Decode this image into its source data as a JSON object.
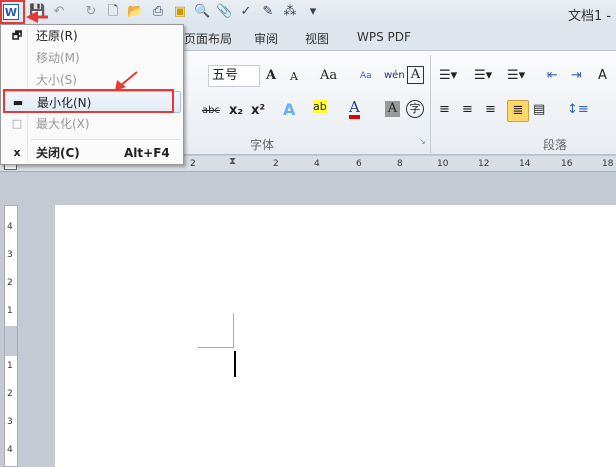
{
  "window": {
    "title": "文档1 -"
  },
  "quick_access": {
    "app_icon": "W",
    "icons": [
      "save-icon",
      "undo-icon",
      "redo-icon",
      "new-icon",
      "open-icon",
      "print-icon",
      "folder-icon",
      "print-preview-icon",
      "attach-icon",
      "spellcheck-icon",
      "edit-icon",
      "structure-icon",
      "customize-icon"
    ]
  },
  "tabs": [
    "页面布局",
    "审阅",
    "视图",
    "WPS PDF"
  ],
  "ribbon": {
    "font_size": "五号",
    "font_group_label": "字体",
    "paragraph_group_label": "段落",
    "buttons": {
      "grow": "A",
      "shrink": "A",
      "change_case": "Aa",
      "strike": "abc",
      "sub": "x₂",
      "sup": "x²",
      "text_effect": "A",
      "highlight": "ab",
      "font_color": "A",
      "char_shade": "A",
      "enclose": "字",
      "pinyin": "wén",
      "char_border": "A"
    }
  },
  "ruler": {
    "h_ticks": [
      "2",
      "2",
      "4",
      "6",
      "8",
      "10",
      "12",
      "14",
      "16",
      "18"
    ],
    "v_ticks": [
      "4",
      "3",
      "2",
      "1",
      "1",
      "2",
      "3",
      "4"
    ]
  },
  "system_menu": {
    "items": [
      {
        "icon": "restore-icon",
        "glyph": "🗗",
        "label": "还原(R)",
        "enabled": true
      },
      {
        "icon": "move-icon",
        "glyph": "",
        "label": "移动(M)",
        "enabled": false
      },
      {
        "icon": "size-icon",
        "glyph": "",
        "label": "大小(S)",
        "enabled": false
      },
      {
        "icon": "minimize-icon",
        "glyph": "▬",
        "label": "最小化(N)",
        "enabled": true,
        "highlighted": true
      },
      {
        "icon": "maximize-icon",
        "glyph": "□",
        "label": "最大化(X)",
        "enabled": false
      },
      {
        "icon": "close-icon",
        "glyph": "x",
        "label": "关闭(C)",
        "shortcut": "Alt+F4",
        "enabled": true,
        "bold": true
      }
    ]
  },
  "colors": {
    "annotation": "#e53935",
    "font_color_bar": "#e00000",
    "active_align": "#ffd86b"
  }
}
